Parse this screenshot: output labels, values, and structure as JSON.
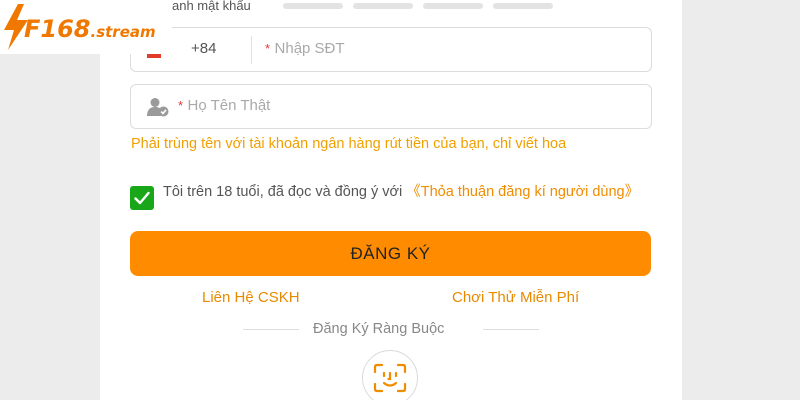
{
  "brand": {
    "logo_main": "F168",
    "logo_suffix": ".stream",
    "color": "#f07800"
  },
  "form": {
    "strength_label": "anh mật khẩu",
    "strength_bars": 4,
    "phone": {
      "prefix": "+84",
      "required_mark": "*",
      "placeholder": "Nhập SĐT",
      "icon": "vietnam-flag-icon"
    },
    "name": {
      "required_mark": "*",
      "placeholder": "Họ Tên Thật",
      "icon": "user-verified-icon"
    },
    "name_hint": "Phải trùng tên với tài khoản ngân hàng rút tiền của bạn, chỉ viết hoa",
    "agreement": {
      "checked": true,
      "text": "Tôi trên 18 tuổi, đã đọc và đồng ý với ",
      "link": "《Thỏa thuận đăng kí người dùng》"
    },
    "submit_label": "ĐĂNG KÝ",
    "link_support": "Liên Hệ CSKH",
    "link_free_play": "Chơi Thử Miễn Phí",
    "or_label": "Đăng Ký Ràng Buộc",
    "face_icon": "face-id-icon"
  },
  "colors": {
    "accent": "#ff8c00",
    "link": "#e88a00",
    "hint": "#f0a000",
    "checkbox": "#19a619",
    "required": "#e03a3a"
  }
}
